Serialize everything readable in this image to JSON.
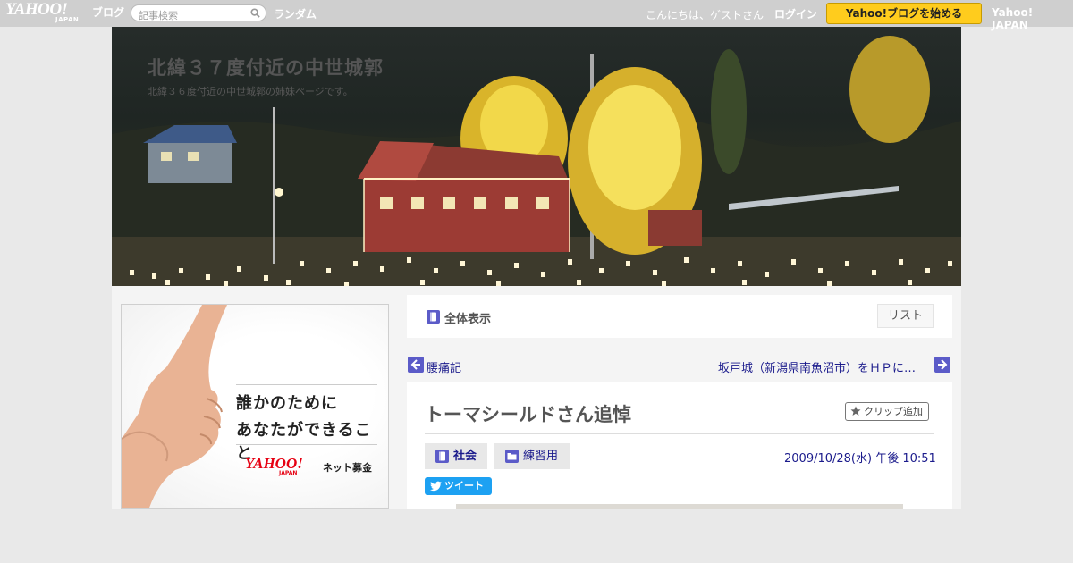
{
  "topbar": {
    "logo_text": "YAHOO!",
    "logo_sub": "JAPAN",
    "blog_label": "ブログ",
    "search_placeholder": "記事検索",
    "random_label": "ランダム",
    "greeting": "こんにちは、ゲストさん",
    "login_label": "ログイン",
    "start_button": "Yahoo!ブログを始める",
    "yahoo_japan_link": "Yahoo! JAPAN"
  },
  "blog": {
    "title": "北緯３７度付近の中世城郭",
    "description": "北緯３６度付近の中世城郭の姉妹ページです。"
  },
  "ad": {
    "line1": "誰かのために",
    "line2": "あなたができること",
    "logo_text": "YAHOO!",
    "logo_sub": "JAPAN",
    "fund_label": "ネット募金"
  },
  "viewbar": {
    "view_all_label": "全体表示",
    "list_label": "リスト"
  },
  "navigation": {
    "prev_label": "腰痛記",
    "next_label": "坂戸城（新潟県南魚沼市）をＨＰに…"
  },
  "article": {
    "title": "トーマシールドさん追悼",
    "clip_label": "クリップ追加",
    "categories": [
      {
        "label": "社会",
        "icon": "book-icon"
      },
      {
        "label": "練習用",
        "icon": "folder-icon"
      }
    ],
    "date": "2009/10/28(水) 午後 10:51",
    "tweet_label": "ツイート"
  },
  "colors": {
    "topbar": "#cfcfcf",
    "start_button": "#ffcc1d",
    "link": "#1b1b8c",
    "icon_accent": "#5b5bc8",
    "tweet": "#1da1f2",
    "ad_logo": "#e60012"
  }
}
